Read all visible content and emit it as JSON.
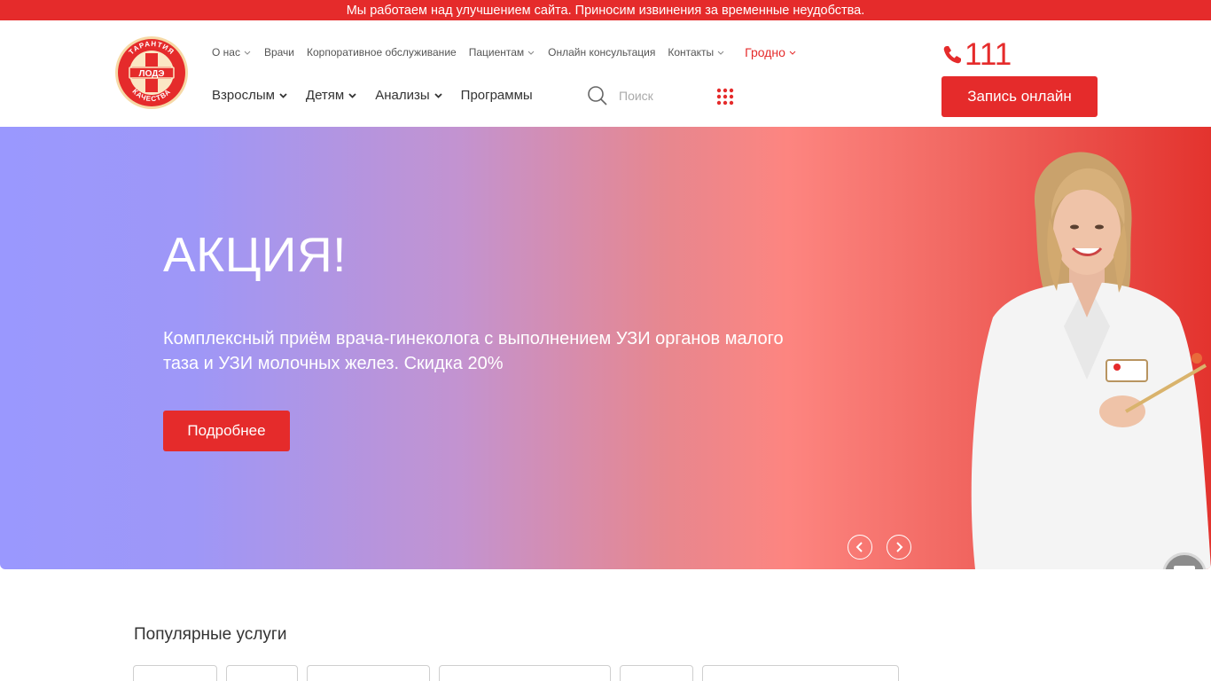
{
  "notice": {
    "text": "Мы работаем над улучшением сайта. Приносим извинения за временные неудобства."
  },
  "logo": {
    "top_text": "ТАРАНТИЯ",
    "center_text": "ЛОДЭ",
    "bottom_text": "КАЧЕСТВА"
  },
  "top_nav": [
    {
      "label": "О нас",
      "has_dropdown": true
    },
    {
      "label": "Врачи",
      "has_dropdown": false
    },
    {
      "label": "Корпоративное обслуживание",
      "has_dropdown": false
    },
    {
      "label": "Пациентам",
      "has_dropdown": true
    },
    {
      "label": "Онлайн консультация",
      "has_dropdown": false
    },
    {
      "label": "Контакты",
      "has_dropdown": true
    }
  ],
  "city": {
    "label": "Гродно"
  },
  "main_nav": [
    {
      "label": "Взрослым",
      "has_dropdown": true
    },
    {
      "label": "Детям",
      "has_dropdown": true
    },
    {
      "label": "Анализы",
      "has_dropdown": true
    },
    {
      "label": "Программы",
      "has_dropdown": false
    }
  ],
  "search": {
    "placeholder": "Поиск",
    "value": ""
  },
  "phone": {
    "number": "111"
  },
  "cta": {
    "label": "Запись онлайн"
  },
  "hero": {
    "title": "АКЦИЯ!",
    "text": "Комплексный приём врача-гинеколога с выполнением УЗИ органов малого таза и УЗИ молочных желез. Скидка 20%",
    "button_label": "Подробнее"
  },
  "popular": {
    "title": "Популярные услуги",
    "chips": [
      {
        "width_hint": "small"
      },
      {
        "width_hint": "small"
      },
      {
        "width_hint": "medium"
      },
      {
        "width_hint": "large"
      },
      {
        "width_hint": "small"
      },
      {
        "width_hint": "large"
      }
    ]
  },
  "colors": {
    "brand_red": "#e52b2b",
    "hero_gradient_start": "#9a98fe",
    "hero_gradient_end": "#e3332e"
  },
  "icons": {
    "phone": "phone-icon",
    "search": "search-icon",
    "apps": "grid-icon",
    "chevron": "chevron-down-icon",
    "chat": "chat-icon",
    "prev": "chevron-left-icon",
    "next": "chevron-right-icon"
  }
}
